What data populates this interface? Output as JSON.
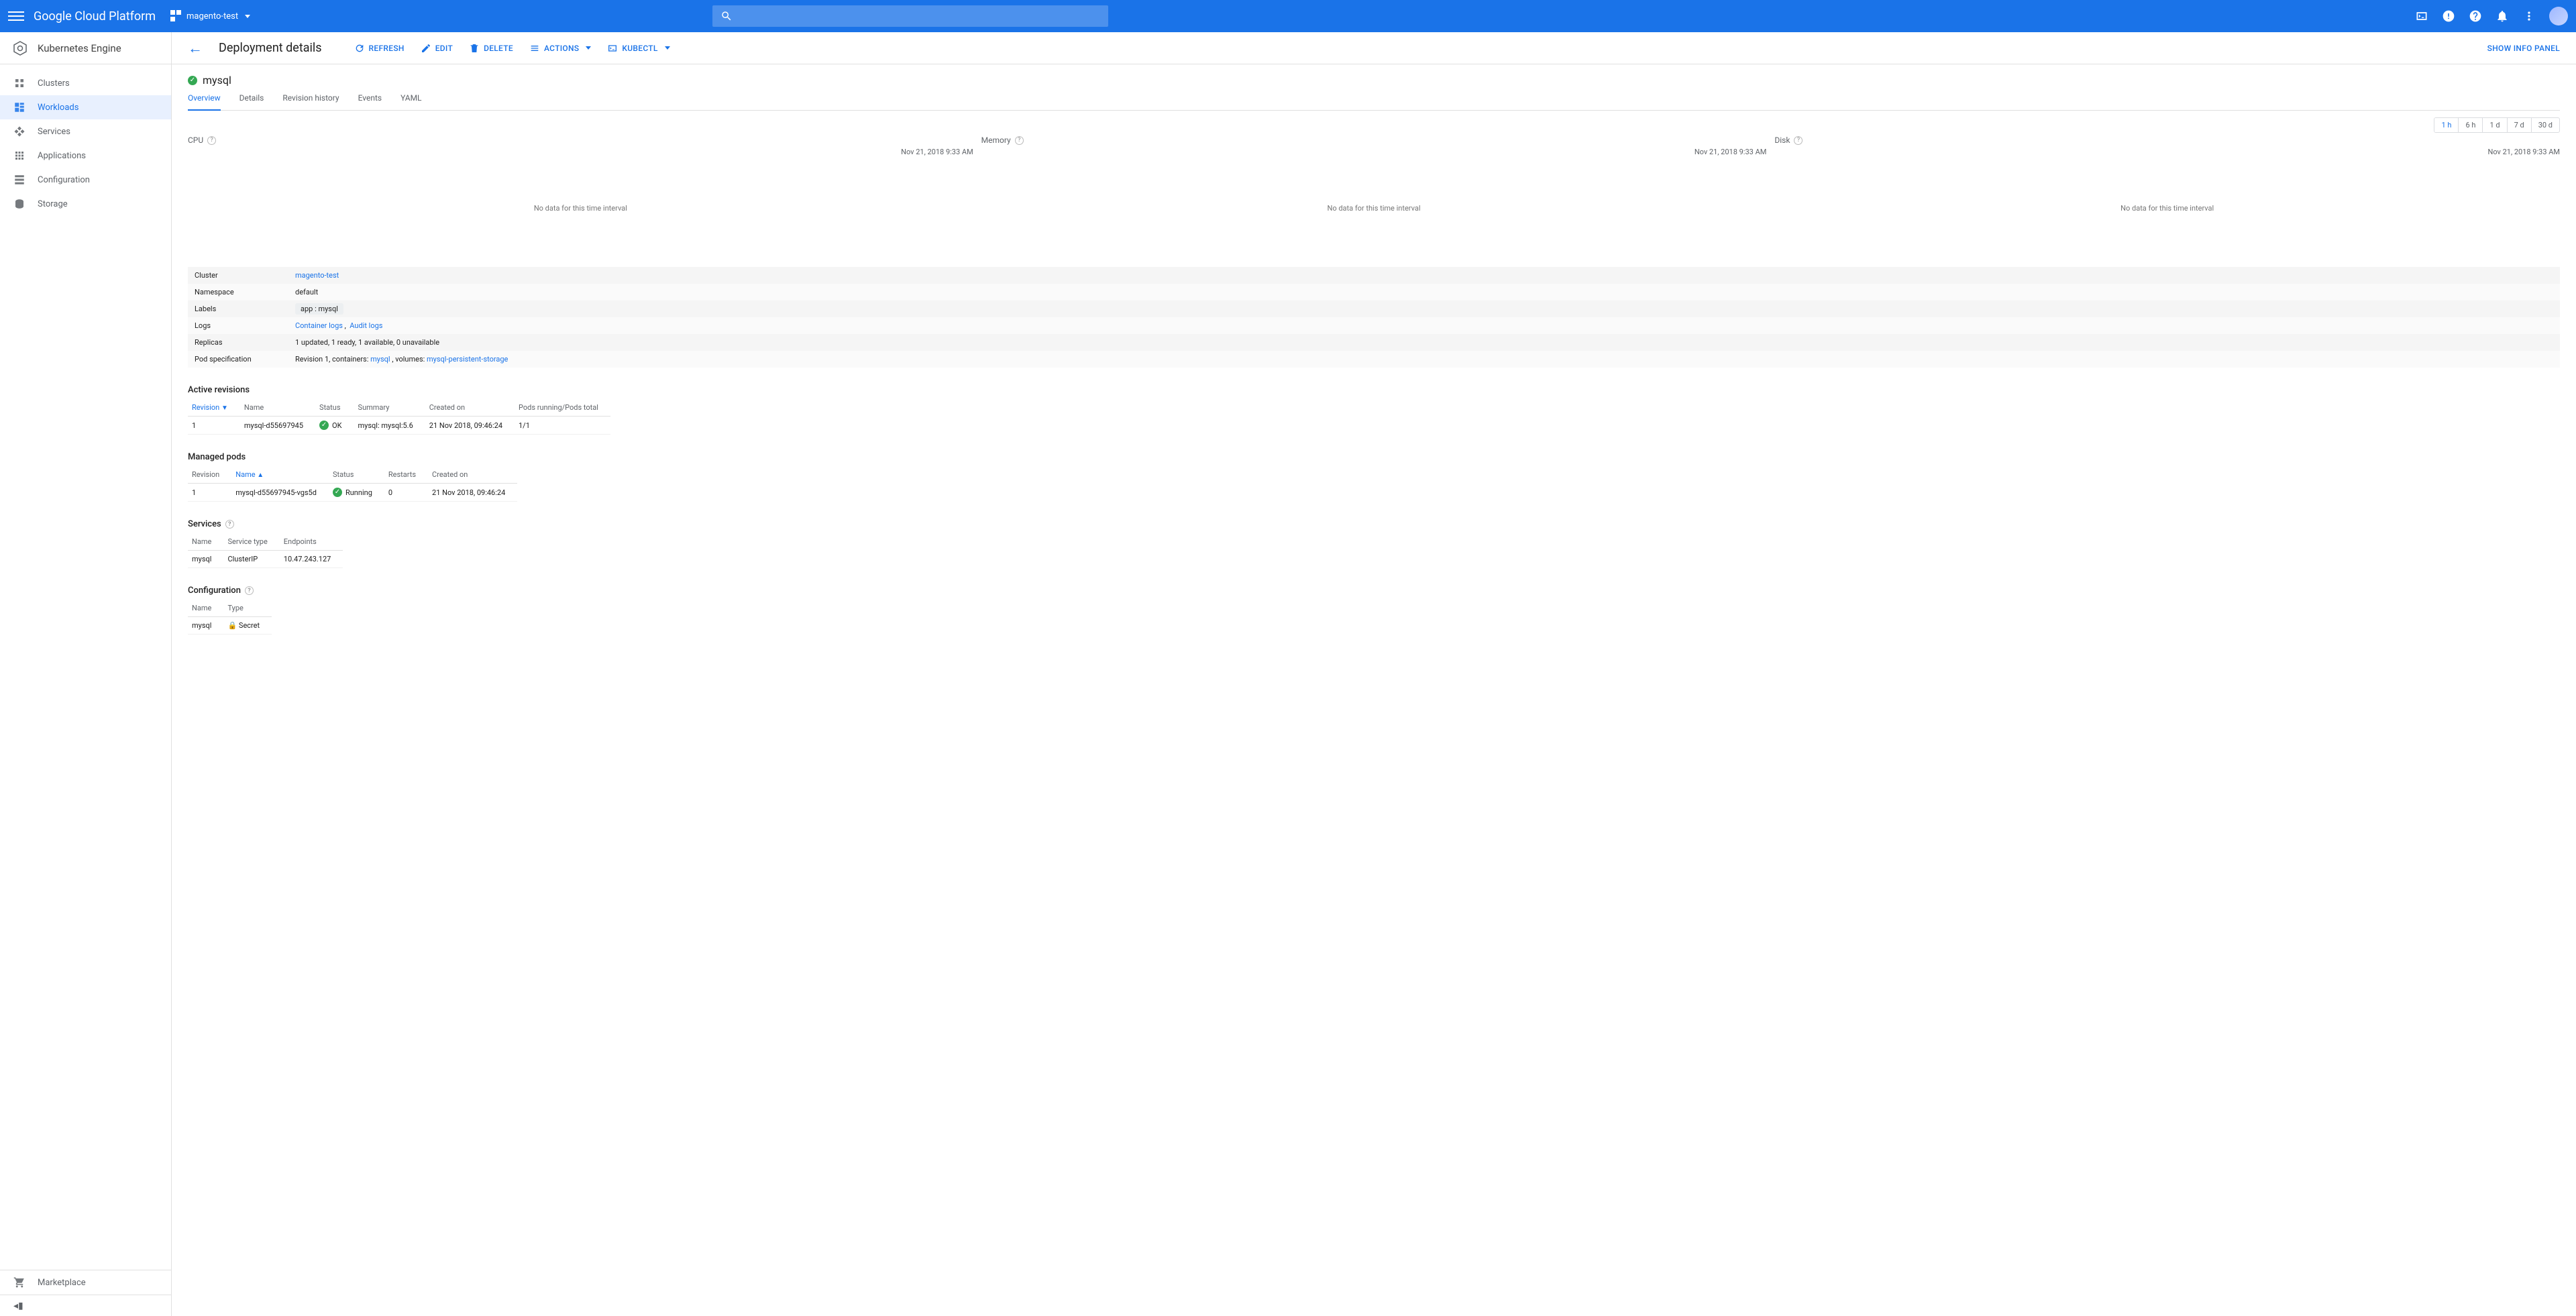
{
  "top": {
    "brand": "Google Cloud Platform",
    "project": "magento-test"
  },
  "sidebar": {
    "product": "Kubernetes Engine",
    "items": [
      {
        "label": "Clusters"
      },
      {
        "label": "Workloads"
      },
      {
        "label": "Services"
      },
      {
        "label": "Applications"
      },
      {
        "label": "Configuration"
      },
      {
        "label": "Storage"
      }
    ],
    "marketplace": "Marketplace"
  },
  "toolbar": {
    "title": "Deployment details",
    "refresh": "REFRESH",
    "edit": "EDIT",
    "delete": "DELETE",
    "actions": "ACTIONS",
    "kubectl": "KUBECTL",
    "show_info": "SHOW INFO PANEL"
  },
  "deployment": {
    "name": "mysql"
  },
  "tabs": [
    "Overview",
    "Details",
    "Revision history",
    "Events",
    "YAML"
  ],
  "range": [
    "1 h",
    "6 h",
    "1 d",
    "7 d",
    "30 d"
  ],
  "charts": {
    "cpu": {
      "title": "CPU",
      "time": "Nov 21, 2018 9:33 AM",
      "no_data": "No data for this time interval"
    },
    "memory": {
      "title": "Memory",
      "time": "Nov 21, 2018 9:33 AM",
      "no_data": "No data for this time interval"
    },
    "disk": {
      "title": "Disk",
      "time": "Nov 21, 2018 9:33 AM",
      "no_data": "No data for this time interval"
    }
  },
  "kv": {
    "cluster_k": "Cluster",
    "cluster_v": "magento-test",
    "namespace_k": "Namespace",
    "namespace_v": "default",
    "labels_k": "Labels",
    "labels_v": "app : mysql",
    "logs_k": "Logs",
    "logs_container": "Container logs",
    "logs_audit": "Audit logs",
    "replicas_k": "Replicas",
    "replicas_v": "1 updated, 1 ready, 1 available, 0 unavailable",
    "pod_k": "Pod specification",
    "pod_prefix": "Revision 1, containers: ",
    "pod_c": "mysql",
    "pod_mid": " , volumes: ",
    "pod_v": "mysql-persistent-storage"
  },
  "active_revisions": {
    "title": "Active revisions",
    "headers": [
      "Revision",
      "Name",
      "Status",
      "Summary",
      "Created on",
      "Pods running/Pods total"
    ],
    "row": {
      "revision": "1",
      "name": "mysql-d55697945",
      "status": "OK",
      "summary": "mysql: mysql:5.6",
      "created": "21 Nov 2018, 09:46:24",
      "pods": "1/1"
    }
  },
  "managed_pods": {
    "title": "Managed pods",
    "headers": [
      "Revision",
      "Name",
      "Status",
      "Restarts",
      "Created on"
    ],
    "row": {
      "revision": "1",
      "name": "mysql-d55697945-vgs5d",
      "status": "Running",
      "restarts": "0",
      "created": "21 Nov 2018, 09:46:24"
    }
  },
  "services": {
    "title": "Services",
    "headers": [
      "Name",
      "Service type",
      "Endpoints"
    ],
    "row": {
      "name": "mysql",
      "type": "ClusterIP",
      "endpoints": "10.47.243.127"
    }
  },
  "config": {
    "title": "Configuration",
    "headers": [
      "Name",
      "Type"
    ],
    "row": {
      "name": "mysql",
      "type": "Secret"
    }
  }
}
